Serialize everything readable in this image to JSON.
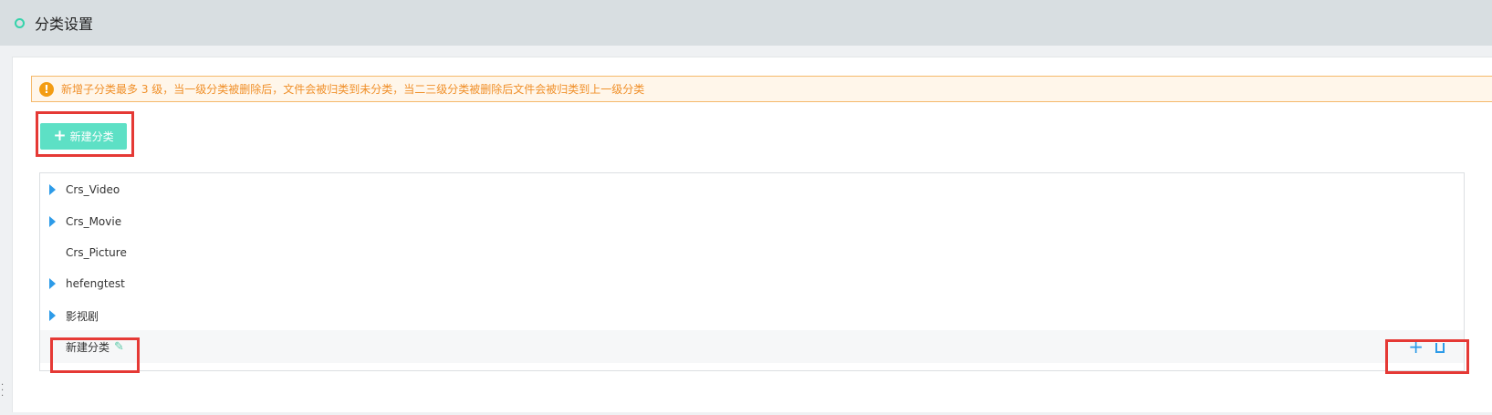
{
  "header": {
    "title": "分类设置"
  },
  "notice": {
    "text": "新增子分类最多 3 级，当一级分类被删除后，文件会被归类到未分类，当二三级分类被删除后文件会被归类到上一级分类",
    "icon": "info-icon"
  },
  "toolbar": {
    "new_category_label": "新建分类"
  },
  "tree": {
    "items": [
      {
        "label": "Crs_Video",
        "has_children": true
      },
      {
        "label": "Crs_Movie",
        "has_children": true
      },
      {
        "label": "Crs_Picture",
        "has_children": false
      },
      {
        "label": "hefengtest",
        "has_children": true
      },
      {
        "label": "影视剧",
        "has_children": true
      },
      {
        "label": "新建分类",
        "has_children": false,
        "editing": true
      }
    ]
  },
  "colors": {
    "accent": "#5de0c5",
    "link": "#2d9be8",
    "warning": "#f39c12",
    "highlight": "#e53935"
  }
}
